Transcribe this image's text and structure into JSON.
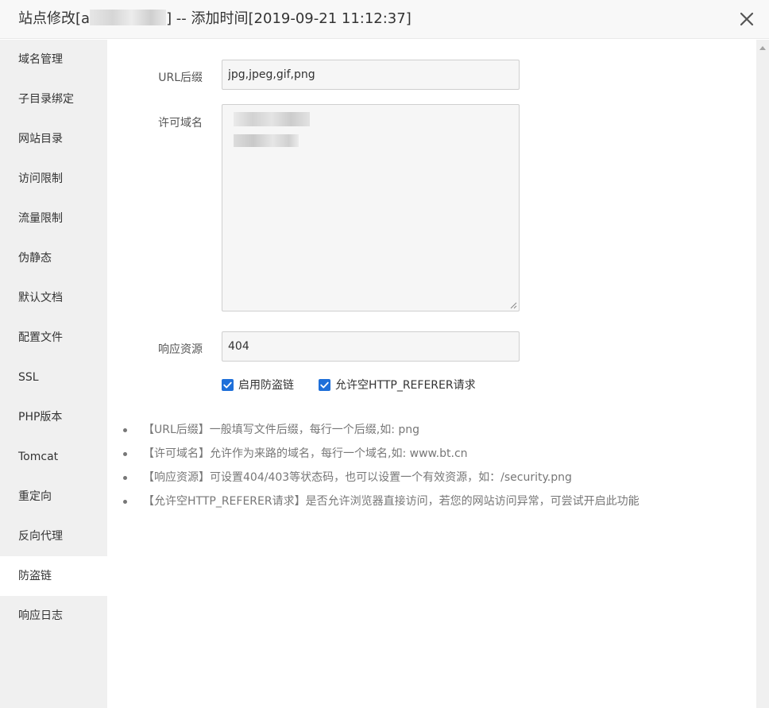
{
  "dialog": {
    "title_prefix": "站点修改[",
    "title_prefix_tail": "a",
    "title_suffix": "] -- 添加时间[2019-09-21 11:12:37]",
    "close_icon": "close-icon"
  },
  "sidebar": {
    "active_index": 13,
    "items": [
      {
        "label": "域名管理"
      },
      {
        "label": "子目录绑定"
      },
      {
        "label": "网站目录"
      },
      {
        "label": "访问限制"
      },
      {
        "label": "流量限制"
      },
      {
        "label": "伪静态"
      },
      {
        "label": "默认文档"
      },
      {
        "label": "配置文件"
      },
      {
        "label": "SSL"
      },
      {
        "label": "PHP版本"
      },
      {
        "label": "Tomcat"
      },
      {
        "label": "重定向"
      },
      {
        "label": "反向代理"
      },
      {
        "label": "防盗链"
      },
      {
        "label": "响应日志"
      }
    ]
  },
  "form": {
    "url_suffix": {
      "label": "URL后缀",
      "value": "jpg,jpeg,gif,png"
    },
    "allowed_domains": {
      "label": "许可域名"
    },
    "response_resource": {
      "label": "响应资源",
      "value": "404"
    },
    "enable_hotlink": {
      "label": "启用防盗链",
      "checked": true
    },
    "allow_empty_referer": {
      "label": "允许空HTTP_REFERER请求",
      "checked": true
    }
  },
  "notes": [
    "【URL后缀】一般填写文件后缀，每行一个后缀,如: png",
    "【许可域名】允许作为来路的域名，每行一个域名,如: www.bt.cn",
    "【响应资源】可设置404/403等状态码，也可以设置一个有效资源，如：/security.png",
    "【允许空HTTP_REFERER请求】是否允许浏览器直接访问，若您的网站访问异常，可尝试开启此功能"
  ],
  "colors": {
    "accent": "#1e6fd9",
    "sidebar_bg": "#f0f0f0",
    "titlebar_bg": "#f8f8f8"
  }
}
